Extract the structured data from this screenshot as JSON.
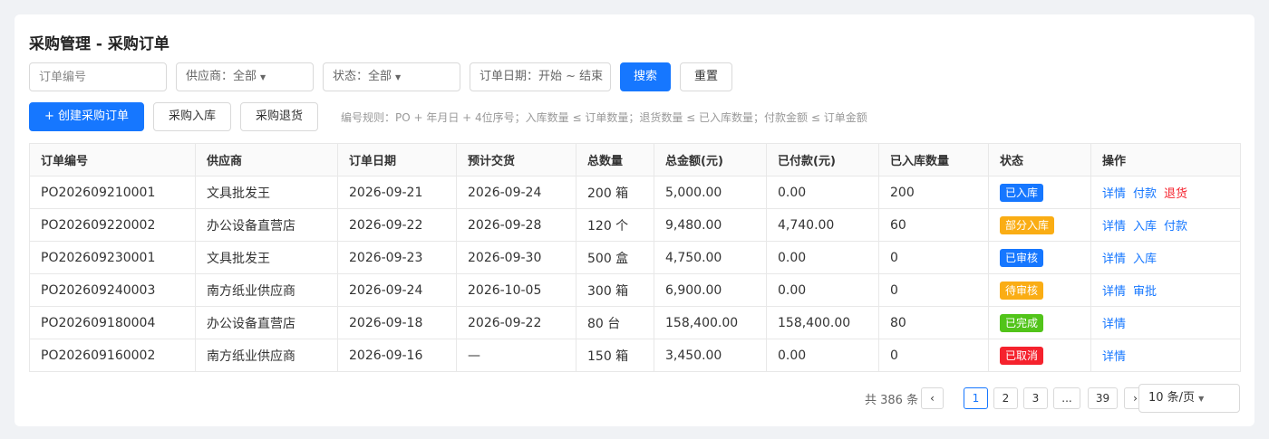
{
  "page": {
    "title": "采购管理 - 采购订单"
  },
  "filters": {
    "order_no_placeholder": "订单编号",
    "supplier": "供应商：全部",
    "status": "状态：全部",
    "date": "订单日期：开始 ~ 结束",
    "search": "搜索",
    "reset": "重置"
  },
  "actions": {
    "create": "+ 创建采购订单",
    "inbound": "采购入库",
    "return": "采购退货",
    "rule": "编号规则：PO + 年月日 + 4位序号；入库数量 ≤ 订单数量；退货数量 ≤ 已入库数量；付款金额 ≤ 订单金额"
  },
  "table": {
    "headers": [
      "订单编号",
      "供应商",
      "订单日期",
      "预计交货",
      "总数量",
      "总金额(元)",
      "已付款(元)",
      "已入库数量",
      "状态",
      "操作"
    ],
    "rows": [
      {
        "order_no": "PO202609210001",
        "supplier": "文具批发王",
        "date": "2026-09-21",
        "delivery": "2026-09-24",
        "qty": "200 箱",
        "amount": "5,000.00",
        "paid": "0.00",
        "received": "200",
        "status": "已入库",
        "status_color": "#1677ff",
        "ops": [
          "详情",
          "付款",
          "退货"
        ],
        "danger_op": "退货"
      },
      {
        "order_no": "PO202609220002",
        "supplier": "办公设备直营店",
        "date": "2026-09-22",
        "delivery": "2026-09-28",
        "qty": "120 个",
        "amount": "9,480.00",
        "paid": "4,740.00",
        "received": "60",
        "status": "部分入库",
        "status_color": "#faad14",
        "ops": [
          "详情",
          "入库",
          "付款"
        ]
      },
      {
        "order_no": "PO202609230001",
        "supplier": "文具批发王",
        "date": "2026-09-23",
        "delivery": "2026-09-30",
        "qty": "500 盒",
        "amount": "4,750.00",
        "paid": "0.00",
        "received": "0",
        "status": "已审核",
        "status_color": "#1677ff",
        "ops": [
          "详情",
          "入库"
        ]
      },
      {
        "order_no": "PO202609240003",
        "supplier": "南方纸业供应商",
        "date": "2026-09-24",
        "delivery": "2026-10-05",
        "qty": "300 箱",
        "amount": "6,900.00",
        "paid": "0.00",
        "received": "0",
        "status": "待审核",
        "status_color": "#faad14",
        "ops": [
          "详情",
          "审批"
        ]
      },
      {
        "order_no": "PO202609180004",
        "supplier": "办公设备直营店",
        "date": "2026-09-18",
        "delivery": "2026-09-22",
        "qty": "80 台",
        "amount": "158,400.00",
        "paid": "158,400.00",
        "received": "80",
        "status": "已完成",
        "status_color": "#52c41a",
        "ops": [
          "详情"
        ]
      },
      {
        "order_no": "PO202609160002",
        "supplier": "南方纸业供应商",
        "date": "2026-09-16",
        "delivery": "—",
        "qty": "150 箱",
        "amount": "3,450.00",
        "paid": "0.00",
        "received": "0",
        "status": "已取消",
        "status_color": "#f5222d",
        "ops": [
          "详情"
        ]
      }
    ]
  },
  "pagination": {
    "total": "共 386 条",
    "prev": "‹",
    "next": "›",
    "pages": [
      "1",
      "2",
      "3",
      "...",
      "39"
    ],
    "current": "1",
    "page_size": "10 条/页"
  }
}
